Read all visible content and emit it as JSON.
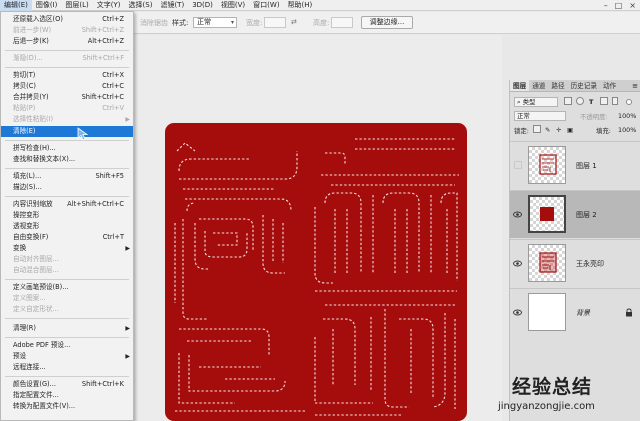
{
  "menubar": {
    "items": [
      "编辑(E)",
      "图像(I)",
      "图层(L)",
      "文字(Y)",
      "选择(S)",
      "滤镜(T)",
      "3D(D)",
      "视图(V)",
      "窗口(W)",
      "帮助(H)"
    ],
    "active": "编辑(E)"
  },
  "options_bar": {
    "antialias_label": "消除锯齿",
    "style_label": "样式:",
    "style_value": "正常",
    "width_label": "宽度:",
    "height_label": "高度:",
    "refine_edge_button": "调整边缘..."
  },
  "edit_menu": {
    "items": [
      {
        "label": "还原载入选区(O)",
        "shortcut": "Ctrl+Z",
        "disabled": false
      },
      {
        "label": "前进一步(W)",
        "shortcut": "Shift+Ctrl+Z",
        "disabled": true
      },
      {
        "label": "后退一步(K)",
        "shortcut": "Alt+Ctrl+Z",
        "disabled": false
      },
      {
        "label": "渐隐(D)...",
        "shortcut": "Shift+Ctrl+F",
        "disabled": true
      },
      {
        "label": "剪切(T)",
        "shortcut": "Ctrl+X",
        "disabled": false
      },
      {
        "label": "拷贝(C)",
        "shortcut": "Ctrl+C",
        "disabled": false
      },
      {
        "label": "合并拷贝(Y)",
        "shortcut": "Shift+Ctrl+C",
        "disabled": false
      },
      {
        "label": "粘贴(P)",
        "shortcut": "Ctrl+V",
        "disabled": true
      },
      {
        "label": "选择性粘贴(I)",
        "shortcut": "",
        "disabled": true
      },
      {
        "label": "清除(E)",
        "shortcut": "",
        "disabled": false,
        "highlighted": true
      },
      {
        "label": "拼写检查(H)...",
        "shortcut": "",
        "disabled": false
      },
      {
        "label": "查找和替换文本(X)...",
        "shortcut": "",
        "disabled": false
      },
      {
        "label": "填充(L)...",
        "shortcut": "Shift+F5",
        "disabled": false
      },
      {
        "label": "描边(S)...",
        "shortcut": "",
        "disabled": false
      },
      {
        "label": "内容识别缩放",
        "shortcut": "Alt+Shift+Ctrl+C",
        "disabled": false
      },
      {
        "label": "操控变形",
        "shortcut": "",
        "disabled": false
      },
      {
        "label": "透视变形",
        "shortcut": "",
        "disabled": false
      },
      {
        "label": "自由变换(F)",
        "shortcut": "Ctrl+T",
        "disabled": false
      },
      {
        "label": "变换",
        "shortcut": "",
        "disabled": false
      },
      {
        "label": "自动对齐图层...",
        "shortcut": "",
        "disabled": true
      },
      {
        "label": "自动混合图层...",
        "shortcut": "",
        "disabled": true
      },
      {
        "label": "定义画笔预设(B)...",
        "shortcut": "",
        "disabled": false
      },
      {
        "label": "定义图案...",
        "shortcut": "",
        "disabled": true
      },
      {
        "label": "定义自定形状...",
        "shortcut": "",
        "disabled": true
      },
      {
        "label": "清理(R)",
        "shortcut": "",
        "disabled": false
      },
      {
        "label": "Adobe PDF 预设...",
        "shortcut": "",
        "disabled": false
      },
      {
        "label": "预设",
        "shortcut": "",
        "disabled": false
      },
      {
        "label": "远程连接...",
        "shortcut": "",
        "disabled": false
      },
      {
        "label": "颜色设置(G)...",
        "shortcut": "Shift+Ctrl+K",
        "disabled": false
      },
      {
        "label": "指定配置文件...",
        "shortcut": "",
        "disabled": false
      },
      {
        "label": "转换为配置文件(V)...",
        "shortcut": "",
        "disabled": false
      }
    ]
  },
  "layers_panel": {
    "tabs": [
      "图层",
      "通道",
      "路径",
      "历史记录",
      "动作"
    ],
    "active_tab": "图层",
    "kind_filter": "类型",
    "blend_mode": "正常",
    "opacity_label": "不透明度:",
    "opacity_value": "100%",
    "lock_label": "锁定:",
    "fill_label": "填充:",
    "fill_value": "100%",
    "layers": [
      {
        "name": "图层 1",
        "visible": false,
        "selected": false,
        "thumb": "stamp-pattern"
      },
      {
        "name": "图层 2",
        "visible": true,
        "selected": true,
        "thumb": "red-square"
      },
      {
        "name": "王永亮印",
        "visible": true,
        "selected": false,
        "thumb": "stamp-pattern"
      },
      {
        "name": "背景",
        "visible": true,
        "selected": false,
        "thumb": "white",
        "locked": true,
        "italic": true
      }
    ]
  },
  "colors": {
    "stamp_red": "#a50d0d",
    "menu_highlight": "#1e79d6"
  },
  "watermark": {
    "title": "经验总结",
    "url": "jingyanzongjie.com"
  }
}
